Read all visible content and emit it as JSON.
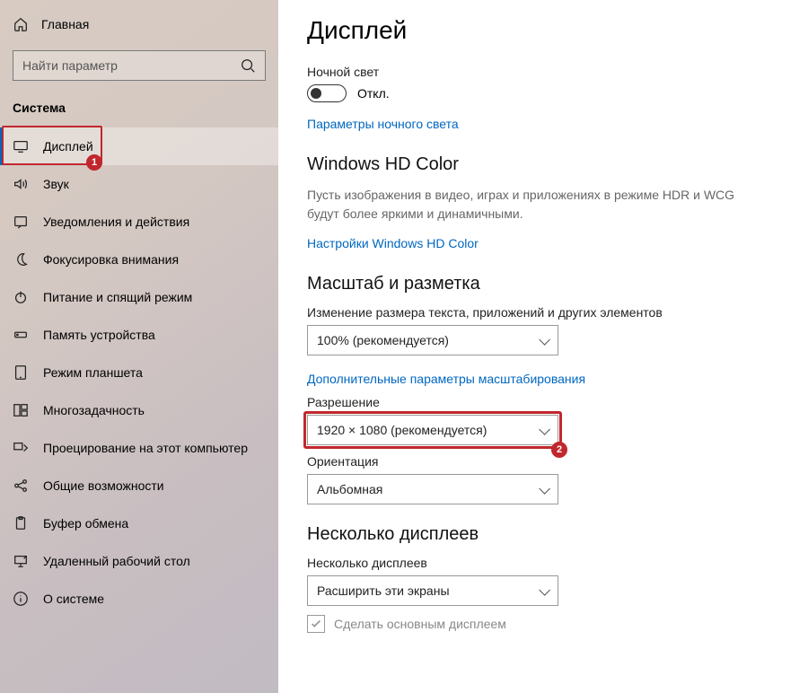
{
  "sidebar": {
    "home": "Главная",
    "search_placeholder": "Найти параметр",
    "category": "Система",
    "items": [
      {
        "label": "Дисплей",
        "selected": true
      },
      {
        "label": "Звук"
      },
      {
        "label": "Уведомления и действия"
      },
      {
        "label": "Фокусировка внимания"
      },
      {
        "label": "Питание и спящий режим"
      },
      {
        "label": "Память устройства"
      },
      {
        "label": "Режим планшета"
      },
      {
        "label": "Многозадачность"
      },
      {
        "label": "Проецирование на этот компьютер"
      },
      {
        "label": "Oбщие возможности"
      },
      {
        "label": "Буфер обмена"
      },
      {
        "label": "Удаленный рабочий стол"
      },
      {
        "label": "О системе"
      }
    ]
  },
  "annotations": {
    "badge1": "1",
    "badge2": "2"
  },
  "main": {
    "title": "Дисплей",
    "nightlight": {
      "label": "Ночной свет",
      "state": "Откл.",
      "link": "Параметры ночного света"
    },
    "hdcolor": {
      "title": "Windows HD Color",
      "body": "Пусть изображения в видео, играх и приложениях в режиме HDR и WCG будут более яркими и динамичными.",
      "link": "Настройки Windows HD Color"
    },
    "scale": {
      "title": "Масштаб и разметка",
      "scale_label": "Изменение размера текста, приложений и других элементов",
      "scale_value": "100% (рекомендуется)",
      "adv_link": "Дополнительные параметры масштабирования",
      "res_label": "Разрешение",
      "res_value": "1920 × 1080 (рекомендуется)",
      "orient_label": "Ориентация",
      "orient_value": "Альбомная"
    },
    "multi": {
      "title": "Несколько дисплеев",
      "label": "Несколько дисплеев",
      "value": "Расширить эти экраны",
      "checkbox": "Сделать основным дисплеем"
    }
  }
}
